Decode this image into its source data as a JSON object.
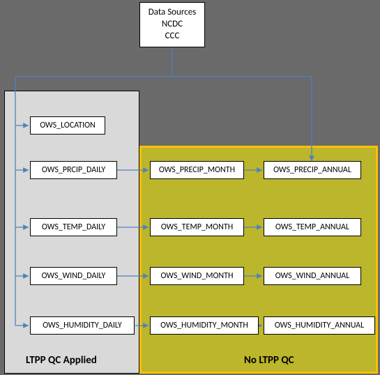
{
  "data_sources": {
    "title": "Data Sources",
    "line1": "NCDC",
    "line2": "CCC"
  },
  "panels": {
    "applied_label": "LTPP QC Applied",
    "noqc_label": "No LTPP QC"
  },
  "nodes": {
    "location": "OWS_LOCATION",
    "prcip_daily": "OWS_PRCIP_DAILY",
    "precip_month": "OWS_PRECIP_MONTH",
    "precip_annual": "OWS_PRECIP_ANNUAL",
    "temp_daily": "OWS_TEMP_DAILY",
    "temp_month": "OWS_TEMP_MONTH",
    "temp_annual": "OWS_TEMP_ANNUAL",
    "wind_daily": "OWS_WIND_DAILY",
    "wind_month": "OWS_WIND_MONTH",
    "wind_annual": "OWS_WIND_ANNUAL",
    "humidity_daily": "OWS_HUMIDITY_DAILY",
    "humidity_month": "OWS_HUMIDITY_MONTH",
    "humidity_annual": "OWS_HUMIDITY_ANNUAL"
  }
}
